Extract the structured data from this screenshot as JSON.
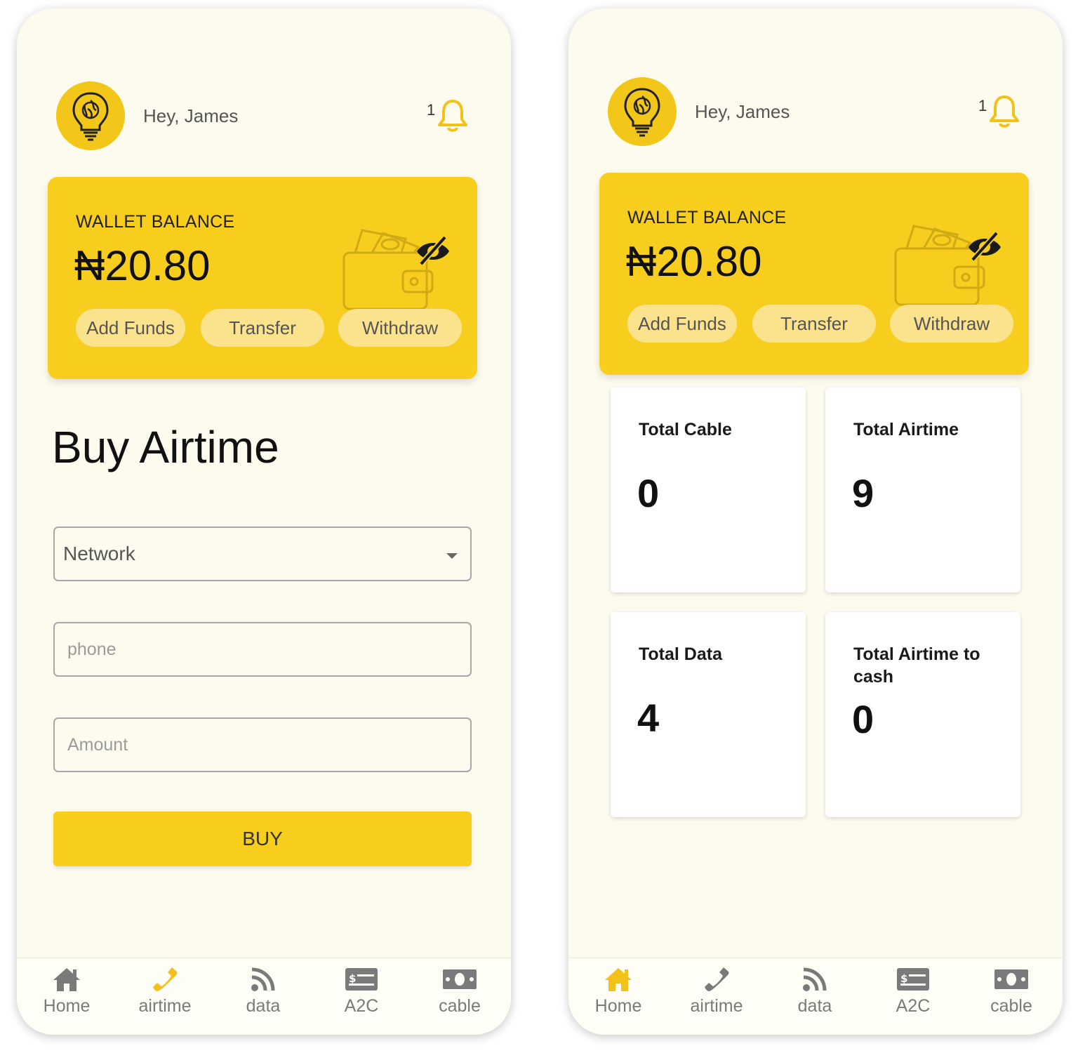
{
  "screens": [
    {
      "greeting": "Hey, James",
      "notification_count": "1",
      "wallet": {
        "label": "WALLET BALANCE",
        "amount": "₦20.80",
        "buttons": [
          "Add Funds",
          "Transfer",
          "Withdraw"
        ]
      },
      "form": {
        "title": "Buy Airtime",
        "network_label": "Network",
        "phone_placeholder": "phone",
        "amount_placeholder": "Amount",
        "submit_label": "BUY"
      },
      "nav": {
        "active": "airtime",
        "items": [
          "Home",
          "airtime",
          "data",
          "A2C",
          "cable"
        ]
      }
    },
    {
      "greeting": "Hey, James",
      "notification_count": "1",
      "wallet": {
        "label": "WALLET BALANCE",
        "amount": "₦20.80",
        "buttons": [
          "Add Funds",
          "Transfer",
          "Withdraw"
        ]
      },
      "stats": [
        {
          "label": "Total Cable",
          "value": "0"
        },
        {
          "label": "Total Airtime",
          "value": "9"
        },
        {
          "label": "Total Data",
          "value": "4"
        },
        {
          "label": "Total Airtime to cash",
          "value": "0"
        }
      ],
      "nav": {
        "active": "Home",
        "items": [
          "Home",
          "airtime",
          "data",
          "A2C",
          "cable"
        ]
      }
    }
  ],
  "colors": {
    "accent": "#f7cd1e",
    "background": "#fdfbee",
    "pill": "#fbe28c",
    "nav_active": "#f2c21a",
    "nav_inactive": "#7a7a7a"
  },
  "icons": {
    "avatar": "lightbulb-brain-icon",
    "notifications": "bell-icon",
    "balance_toggle": "eye-off-icon",
    "wallet_art": "wallet-icon",
    "nav": [
      "home-icon",
      "phone-icon",
      "rss-icon",
      "money-check-icon",
      "money-bill-icon"
    ]
  }
}
